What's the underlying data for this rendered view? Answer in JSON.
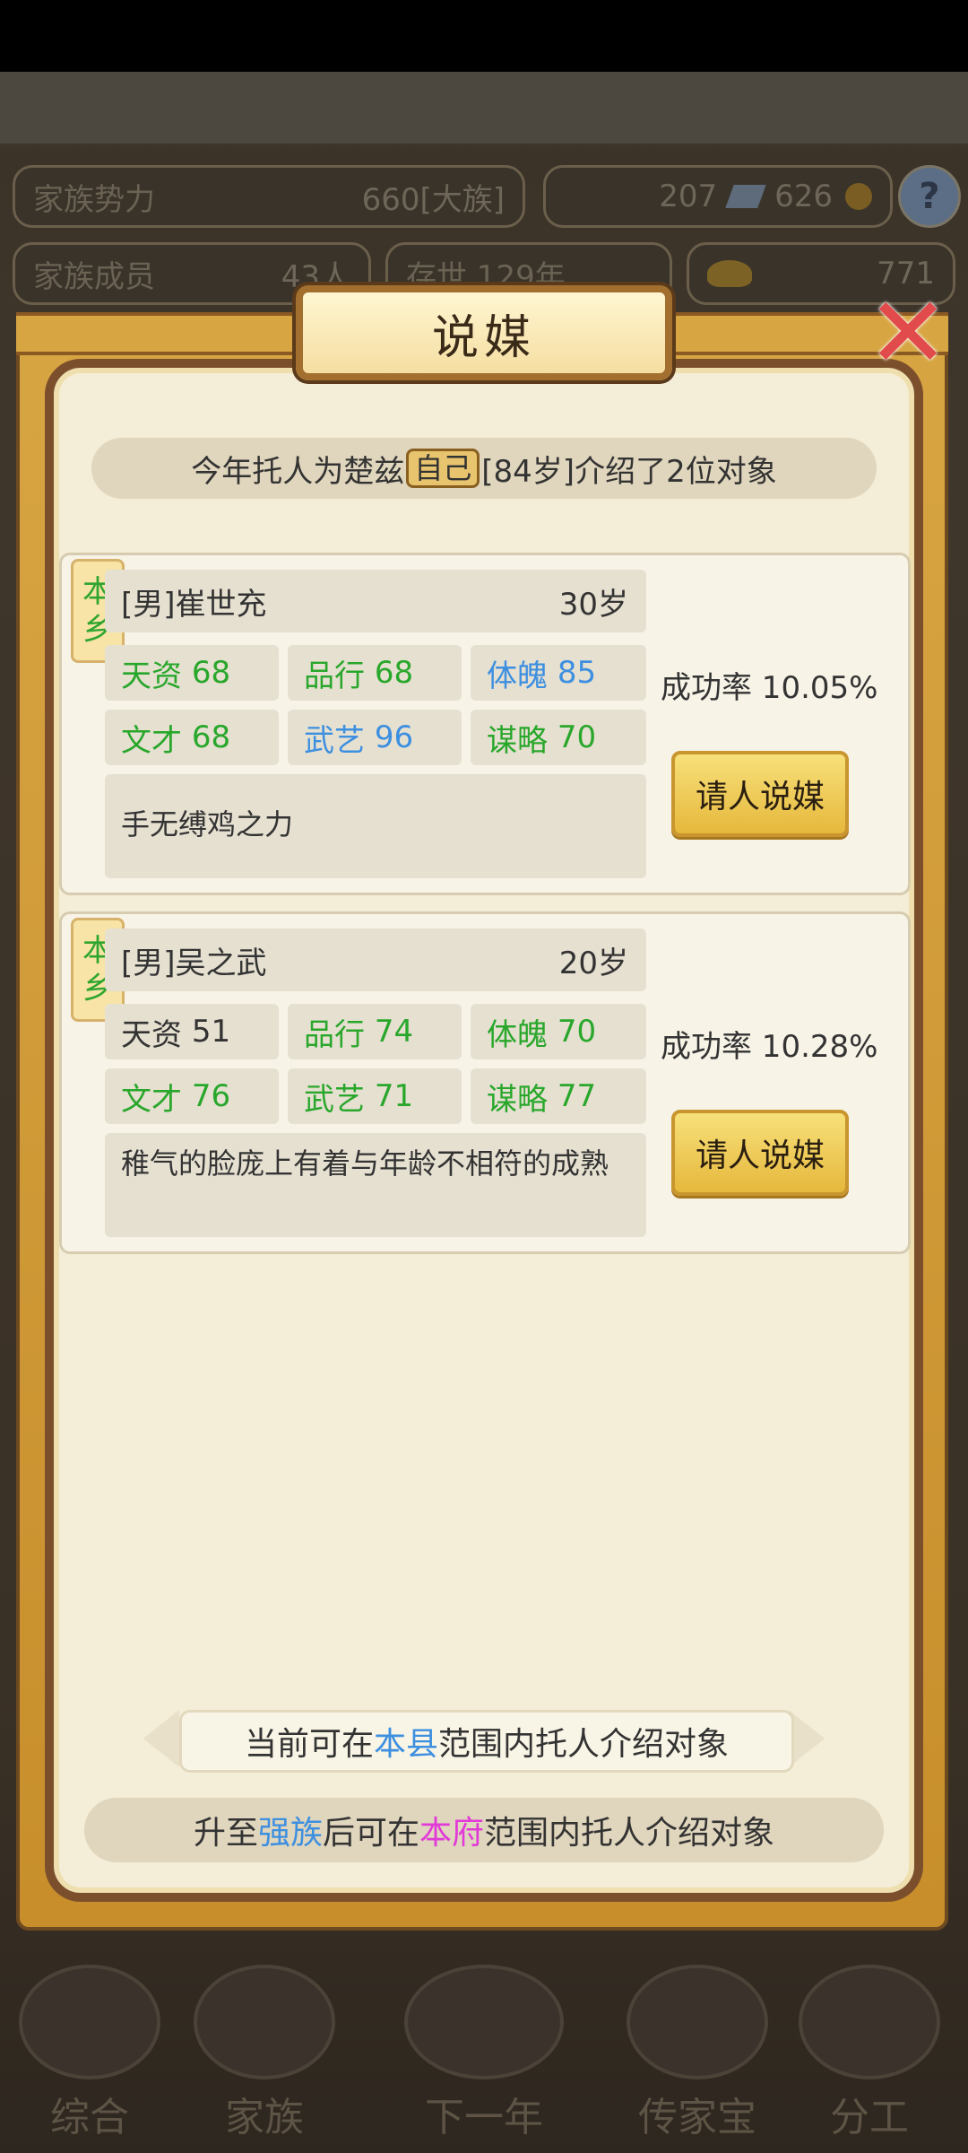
{
  "hud": {
    "family_power_label": "家族势力",
    "family_power_value": "660",
    "family_power_rank": "[大族]",
    "currency_a": "207",
    "currency_b": "626",
    "family_members_label": "家族成员",
    "family_members_value": "43人",
    "generation": "存世 129年",
    "gold": "771"
  },
  "dialog": {
    "title": "说媒",
    "info": {
      "prefix": "今年托人为楚兹",
      "self_tag": "自己",
      "suffix": "[84岁]介绍了2位对象"
    },
    "candidates": [
      {
        "region": [
          "本",
          "乡"
        ],
        "name": "[男]崔世充",
        "age": "30岁",
        "stats": [
          {
            "label": "天资",
            "value": "68",
            "color": "green"
          },
          {
            "label": "品行",
            "value": "68",
            "color": "green"
          },
          {
            "label": "体魄",
            "value": "85",
            "color": "blue"
          },
          {
            "label": "文才",
            "value": "68",
            "color": "green"
          },
          {
            "label": "武艺",
            "value": "96",
            "color": "blue"
          },
          {
            "label": "谋略",
            "value": "70",
            "color": "green"
          }
        ],
        "description": "手无缚鸡之力",
        "success_rate": "成功率 10.05%",
        "button": "请人说媒"
      },
      {
        "region": [
          "本",
          "乡"
        ],
        "name": "[男]吴之武",
        "age": "20岁",
        "stats": [
          {
            "label": "天资",
            "value": "51",
            "color": "plain"
          },
          {
            "label": "品行",
            "value": "74",
            "color": "green"
          },
          {
            "label": "体魄",
            "value": "70",
            "color": "green"
          },
          {
            "label": "文才",
            "value": "76",
            "color": "green"
          },
          {
            "label": "武艺",
            "value": "71",
            "color": "green"
          },
          {
            "label": "谋略",
            "value": "77",
            "color": "green"
          }
        ],
        "description": "稚气的脸庞上有着与年龄不相符的成熟",
        "success_rate": "成功率 10.28%",
        "button": "请人说媒"
      }
    ],
    "scope": {
      "prefix": "当前可在",
      "highlight": "本县",
      "suffix": "范围内托人介绍对象"
    },
    "upgrade": {
      "p1": "升至",
      "h1": "强族",
      "p2": "后可在",
      "h2": "本府",
      "p3": "范围内托人介绍对象"
    },
    "close_icon": "close-icon"
  },
  "nav": [
    "综合",
    "家族",
    "下一年",
    "传家宝",
    "分工"
  ],
  "colors": {
    "green": "#29a72b",
    "blue": "#3d8fe0",
    "pink": "#e23ad9",
    "gold": "#e6b83c"
  }
}
